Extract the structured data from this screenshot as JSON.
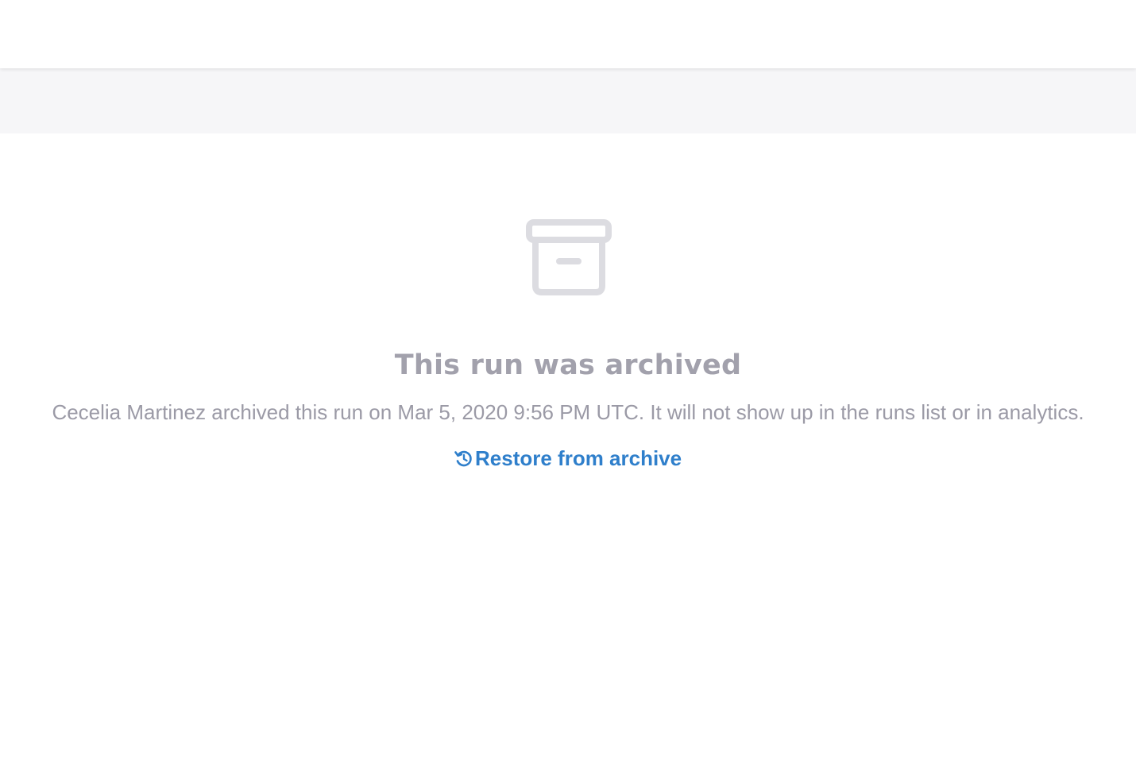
{
  "empty_state": {
    "icon": "archive-box-icon",
    "title": "This run was archived",
    "description": "Cecelia Martinez archived this run on Mar 5, 2020 9:56 PM UTC. It will not show up in the runs list or in analytics.",
    "restore_action": {
      "icon": "restore-history-icon",
      "label": "Restore from archive"
    }
  },
  "colors": {
    "muted_text": "#a2a1ac",
    "icon_gray": "#dcdce1",
    "link_blue": "#2f7fcb",
    "subheader_bg": "#f6f6f8"
  }
}
